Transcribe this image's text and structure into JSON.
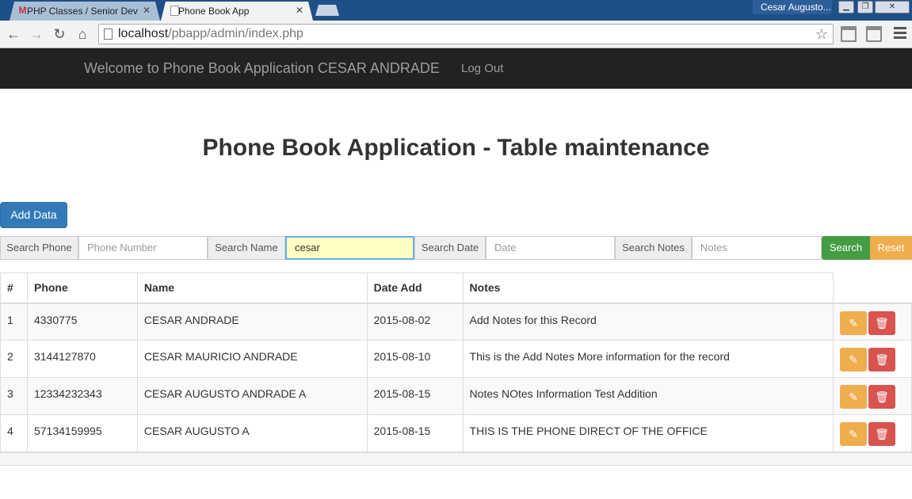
{
  "browser": {
    "tabs": [
      {
        "title": "PHP Classes / Senior Develop",
        "icon": "gmail-icon",
        "active": false
      },
      {
        "title": "Phone Book App",
        "icon": "page-icon",
        "active": true
      }
    ],
    "profile_name": "Cesar Augusto...",
    "url_host": "localhost",
    "url_path": "/pbapp/admin/index.php"
  },
  "navbar": {
    "brand": "Welcome to Phone Book Application CESAR ANDRADE",
    "logout_label": "Log Out"
  },
  "page": {
    "title": "Phone Book Application - Table maintenance",
    "add_button": "Add Data"
  },
  "search": {
    "phone_label": "Search Phone",
    "phone_placeholder": "Phone Number",
    "name_label": "Search Name",
    "name_value": "cesar",
    "date_label": "Search Date",
    "date_placeholder": "Date",
    "notes_label": "Search Notes",
    "notes_placeholder": "Notes",
    "search_button": "Search",
    "reset_button": "Reset"
  },
  "table": {
    "headers": [
      "#",
      "Phone",
      "Name",
      "Date Add",
      "Notes"
    ],
    "rows": [
      {
        "num": "1",
        "phone": "4330775",
        "name": "CESAR ANDRADE",
        "date": "2015-08-02",
        "notes": "Add Notes for this Record"
      },
      {
        "num": "2",
        "phone": "3144127870",
        "name": "CESAR MAURICIO ANDRADE",
        "date": "2015-08-10",
        "notes": "This is the Add Notes More information for the record"
      },
      {
        "num": "3",
        "phone": "12334232343",
        "name": "CESAR AUGUSTO ANDRADE A",
        "date": "2015-08-15",
        "notes": "Notes NOtes Information Test Addition"
      },
      {
        "num": "4",
        "phone": "57134159995",
        "name": "CESAR AUGUSTO A",
        "date": "2015-08-15",
        "notes": "THIS IS THE PHONE DIRECT OF THE OFFICE"
      }
    ]
  },
  "colors": {
    "navbar_bg": "#222222",
    "primary": "#337ab7",
    "success": "#449d44",
    "warning": "#f0ad4e",
    "danger": "#d9534f"
  }
}
